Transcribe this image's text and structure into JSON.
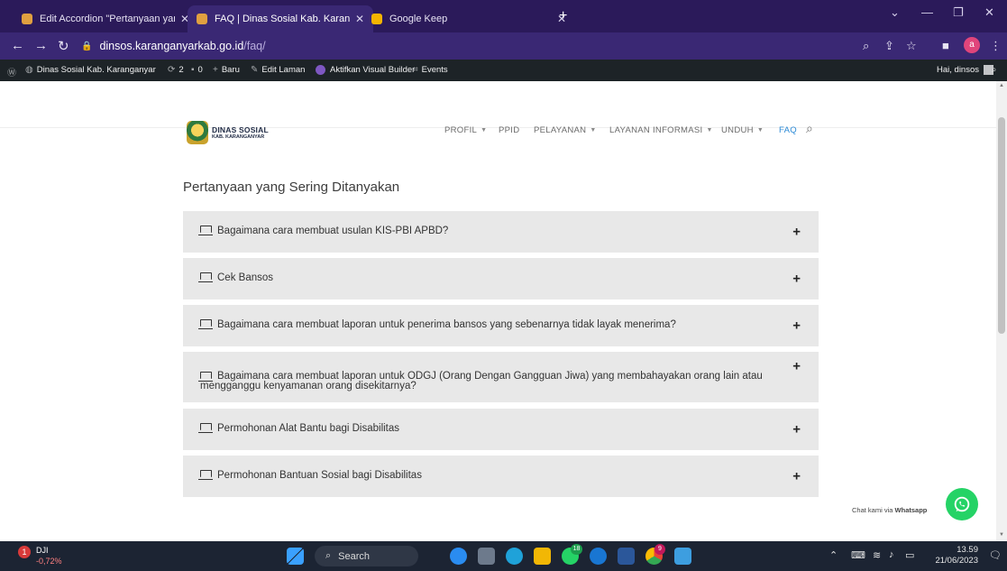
{
  "browser": {
    "tabs": [
      {
        "title": "Edit Accordion \"Pertanyaan yang",
        "close": "✕"
      },
      {
        "title": "FAQ | Dinas Sosial Kab. Karangan",
        "close": "✕"
      },
      {
        "title": "Google Keep",
        "close": "✕"
      }
    ],
    "new_tab": "+",
    "url_host": "dinsos.karanganyarkab.go.id",
    "url_path": "/faq/",
    "profile_initial": "a"
  },
  "wp_admin_bar": {
    "site_name": "Dinas Sosial Kab. Karanganyar",
    "updates": "2",
    "comments": "0",
    "new": "Baru",
    "edit": "Edit Laman",
    "visual_builder": "Aktifkan Visual Builder",
    "events": "Events",
    "greeting": "Hai, dinsos"
  },
  "site": {
    "logo_line1": "DINAS SOSIAL",
    "logo_line2": "KAB. KARANGANYAR",
    "menu": [
      {
        "label": "PROFIL",
        "dropdown": true
      },
      {
        "label": "PPID",
        "dropdown": false
      },
      {
        "label": "PELAYANAN",
        "dropdown": true
      },
      {
        "label": "LAYANAN INFORMASI",
        "dropdown": true
      },
      {
        "label": "UNDUH",
        "dropdown": true
      },
      {
        "label": "FAQ",
        "dropdown": false,
        "active": true
      }
    ]
  },
  "faq": {
    "title": "Pertanyaan yang Sering Ditanyakan",
    "items": [
      {
        "question": "Bagaimana cara membuat usulan KIS-PBI APBD?"
      },
      {
        "question": "Cek Bansos"
      },
      {
        "question": "Bagaimana cara membuat laporan untuk penerima bansos yang sebenarnya tidak layak menerima?"
      },
      {
        "question": "Bagaimana cara membuat laporan untuk ODGJ (Orang Dengan Gangguan Jiwa) yang membahayakan orang lain atau mengganggu kenyamanan orang disekitarnya?"
      },
      {
        "question": "Permohonan Alat Bantu bagi Disabilitas"
      },
      {
        "question": "Permohonan Bantuan Sosial bagi Disabilitas"
      }
    ],
    "expand_icon": "+"
  },
  "whatsapp": {
    "label_prefix": "Chat kami via ",
    "label_brand": "Whatsapp"
  },
  "taskbar": {
    "stock_name": "DJI",
    "stock_change": "-0,72%",
    "stock_badge": "1",
    "search_placeholder": "Search",
    "whatsapp_badge": "18",
    "chrome_badge": "9",
    "time": "13.59",
    "date": "21/06/2023"
  },
  "colors": {
    "tab_bar": "#2b1a5a",
    "address_bar": "#3a2874",
    "wp_bar": "#1d2327",
    "accordion_bg": "#e8e8e8",
    "menu_active": "#2b8ad6",
    "whatsapp_green": "#25d366",
    "taskbar": "#1c2433"
  }
}
